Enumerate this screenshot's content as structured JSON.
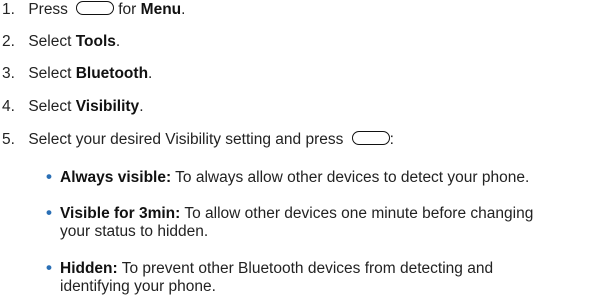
{
  "steps": [
    {
      "num": "1.",
      "pre": "Press",
      "mid": "for",
      "bold": "Menu",
      "post": "."
    },
    {
      "num": "2.",
      "pre": "Select",
      "bold": "Tools",
      "post": "."
    },
    {
      "num": "3.",
      "pre": "Select",
      "bold": "Bluetooth",
      "post": "."
    },
    {
      "num": "4.",
      "pre": "Select",
      "bold": "Visibility",
      "post": "."
    },
    {
      "num": "5.",
      "pre": "Select your desired Visibility setting and press",
      "post": ":"
    }
  ],
  "bullets": [
    {
      "bold": "Always visible:",
      "text": "To always allow other devices to detect your phone."
    },
    {
      "bold": "Visible for 3min:",
      "text": "To allow other devices one minute before changing",
      "cont": "your status to hidden."
    },
    {
      "bold": "Hidden:",
      "text": "To prevent other Bluetooth devices from detecting and",
      "cont": "identifying your phone."
    }
  ],
  "icons": {
    "key": "softkey-button-icon",
    "bullet_color": "#2a6fb5"
  }
}
